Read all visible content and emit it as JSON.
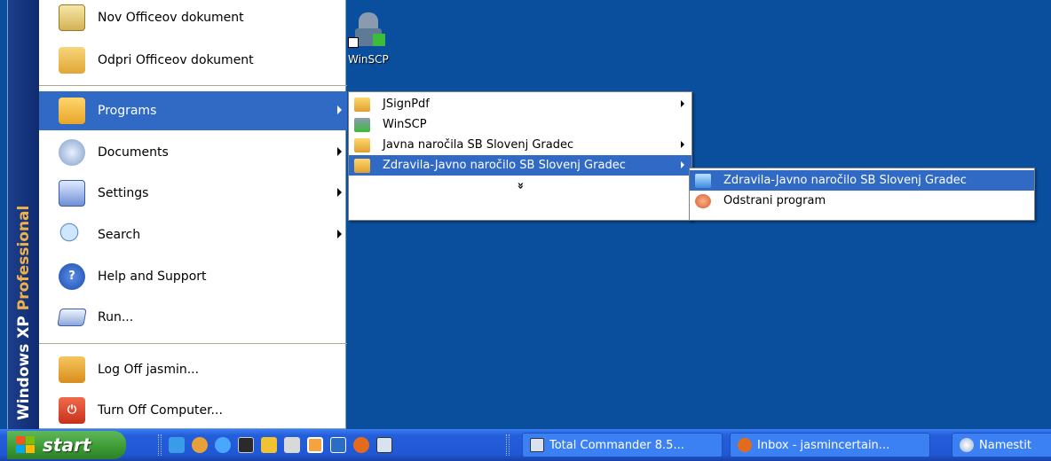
{
  "desktop": {
    "icons": [
      {
        "label": "WinSCP",
        "icon": "winscp-icon"
      }
    ]
  },
  "start_menu": {
    "band_text_main": "Windows XP",
    "band_text_edition": "Professional",
    "pinned": [
      {
        "label": "Nov Officeov dokument",
        "icon": "new-office-document-icon"
      },
      {
        "label": "Odpri Officeov dokument",
        "icon": "open-office-document-icon"
      }
    ],
    "items": [
      {
        "label": "Programs",
        "icon": "programs-icon",
        "has_submenu": true,
        "selected": true
      },
      {
        "label": "Documents",
        "icon": "documents-icon",
        "has_submenu": true
      },
      {
        "label": "Settings",
        "icon": "settings-icon",
        "has_submenu": true
      },
      {
        "label": "Search",
        "icon": "search-icon",
        "has_submenu": true
      },
      {
        "label": "Help and Support",
        "icon": "help-icon"
      },
      {
        "label": "Run...",
        "icon": "run-icon"
      }
    ],
    "bottom": [
      {
        "label": "Log Off jasmin...",
        "icon": "log-off-icon"
      },
      {
        "label": "Turn Off Computer...",
        "icon": "power-icon"
      }
    ]
  },
  "programs_submenu": {
    "items": [
      {
        "label": "JSignPdf",
        "icon": "program-group-icon",
        "has_submenu": true
      },
      {
        "label": "WinSCP",
        "icon": "winscp-icon",
        "has_submenu": false
      },
      {
        "label": "Javna naročila SB Slovenj Gradec",
        "icon": "program-group-icon",
        "has_submenu": true
      },
      {
        "label": "Zdravila-Javno naročilo SB Slovenj Gradec",
        "icon": "program-group-icon",
        "has_submenu": true,
        "selected": true
      }
    ],
    "expand_glyph": "»"
  },
  "zdravila_submenu": {
    "items": [
      {
        "label": "Zdravila-Javno naročilo SB Slovenj Gradec",
        "icon": "application-icon",
        "selected": true
      },
      {
        "label": "Odstrani program",
        "icon": "uninstall-icon"
      }
    ]
  },
  "taskbar": {
    "start_label": "start",
    "quick_launch": [
      "ie-icon",
      "media-icon",
      "ie-blue-icon",
      "console-icon",
      "app-icon",
      "user-icon",
      "clock-icon",
      "vb-icon",
      "firefox-icon",
      "floppy-icon"
    ],
    "tasks": [
      {
        "label": "Total Commander 8.5...",
        "icon": "total-commander-icon"
      },
      {
        "label": "Inbox - jasmincertain...",
        "icon": "firefox-icon"
      },
      {
        "label": "Namestit",
        "icon": "installer-icon"
      }
    ]
  },
  "colors": {
    "desktop": "#0a4f9e",
    "selection": "#316ac5",
    "start_button": "#3c9a33",
    "taskbar": "#245edb"
  }
}
